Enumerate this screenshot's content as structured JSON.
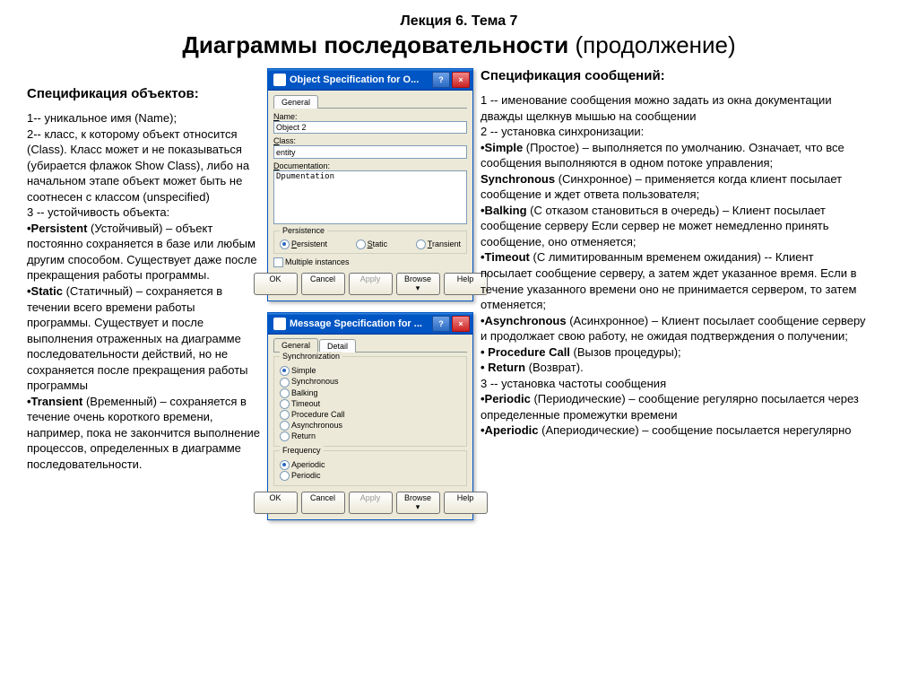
{
  "header": {
    "top": "Лекция 6. Тема 7",
    "main_bold": "Диаграммы последовательности",
    "main_rest": " (продолжение)"
  },
  "left": {
    "title": "Спецификация объектов:",
    "text1": "1-- уникальное имя (Name);\n2-- класс, к которому объект относится (Class). Класс может и не показываться (убирается флажок Show Class), либо на начальном этапе объект может быть не соотнесен с классом (unspecified)\n3 -- устойчивость объекта:",
    "persistent_b": "•Persistent",
    "persistent": " (Устойчивый) – объект постоянно сохраняется в базе или любым другим способом. Существует даже после прекращения работы программы.",
    "static_b": "•Static",
    "static": " (Статичный) – сохраняется в течении всего времени работы программы. Существует и после выполнения отраженных на диаграмме последовательности действий, но не сохраняется после прекращения работы программы",
    "transient_b": "•Transient",
    "transient": " (Временный) – сохраняется в течение очень короткого времени, например, пока не закончится выполнение процессов, определенных в диаграмме последовательности."
  },
  "center": {
    "win1": {
      "title": "Object Specification for O...",
      "tab": "General",
      "name_label": "Name:",
      "name_value": "Object 2",
      "class_label": "Class:",
      "class_value": "entity",
      "doc_label": "Documentation:",
      "doc_value": "Dpumentation",
      "persistence_title": "Persistence",
      "r_persistent": "Persistent",
      "r_static": "Static",
      "r_transient": "Transient",
      "multi": "Multiple instances",
      "btn_ok": "OK",
      "btn_cancel": "Cancel",
      "btn_apply": "Apply",
      "btn_browse": "Browse ▾",
      "btn_help": "Help"
    },
    "win2": {
      "title": "Message Specification for ...",
      "tab1": "General",
      "tab2": "Detail",
      "sync_title": "Synchronization",
      "r_simple": "Simple",
      "r_synchronous": "Synchronous",
      "r_balking": "Balking",
      "r_timeout": "Timeout",
      "r_procedure": "Procedure Call",
      "r_async": "Asynchronous",
      "r_return": "Return",
      "freq_title": "Frequency",
      "r_aperiodic": "Aperiodic",
      "r_periodic": "Periodic",
      "btn_ok": "OK",
      "btn_cancel": "Cancel",
      "btn_apply": "Apply",
      "btn_browse": "Browse ▾",
      "btn_help": "Help"
    }
  },
  "right": {
    "title": "Спецификация сообщений:",
    "p1": "1 -- именование сообщения можно задать из окна документации дважды щелкнув мышью на сообщении\n2 -- установка синхронизации:",
    "simple_b": "•Simple",
    "simple": " (Простое) – выполняется по умолчанию. Означает, что все сообщения выполняются в одном потоке управления;",
    "sync_b": "Synchronous",
    "sync": " (Синхронное) – применяется когда клиент посылает сообщение и ждет ответа пользователя;",
    "balking_b": "•Balking",
    "balking": " (С отказом становиться в очередь) – Клиент посылает сообщение серверу Если сервер не может немедленно принять сообщение, оно отменяется;",
    "timeout_b": "•Timeout",
    "timeout": " (С лимитированным временем ожидания) -- Клиент посылает сообщение серверу, а затем ждет указанное время. Если в течение указанного времени оно не принимается сервером, то затем отменяется;",
    "async_b": "•Asynchronous",
    "async": " (Асинхронное) – Клиент посылает сообщение серверу и продолжает свою работу, не ожидая подтверждения о получении;",
    "proc_b": "• Procedure Call",
    "proc": " (Вызов процедуры);",
    "return_b": "• Return",
    "return": " (Возврат).",
    "p3": "3 -- установка частоты сообщения",
    "periodic_b": "•Periodic",
    "periodic": " (Периодические) – сообщение регулярно посылается через определенные промежутки времени",
    "aperiodic_b": "•Aperiodic",
    "aperiodic": " (Апериодические) – сообщение посылается нерегулярно"
  }
}
